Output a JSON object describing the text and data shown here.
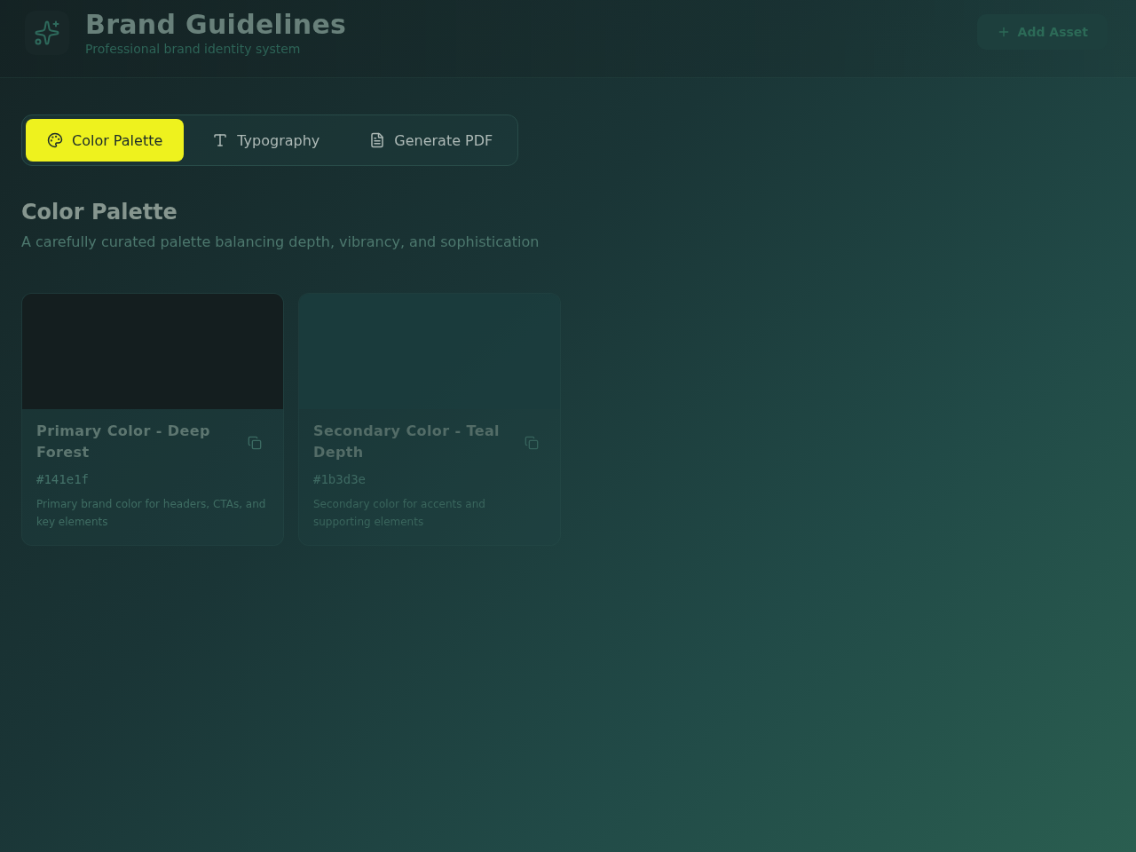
{
  "header": {
    "title": "Brand Guidelines",
    "subtitle": "Professional brand identity system",
    "action": {
      "label": "Add Asset"
    }
  },
  "tabs": [
    {
      "label": "Color Palette",
      "kind": "palette",
      "selected": true
    },
    {
      "label": "Typography",
      "kind": "type",
      "selected": false
    },
    {
      "label": "Generate PDF",
      "kind": "document",
      "selected": false
    }
  ],
  "section": {
    "title": "Color Palette",
    "description": "A carefully curated palette balancing depth, vibrancy, and sophistication"
  },
  "colors": [
    {
      "name": "Primary Color - Deep Forest",
      "hex": "#141e1f",
      "description": "Primary brand color for headers, CTAs, and key elements"
    },
    {
      "name": "Secondary Color - Teal Depth",
      "hex": "#1b3d3e",
      "description": "Secondary color for accents and supporting elements"
    }
  ]
}
